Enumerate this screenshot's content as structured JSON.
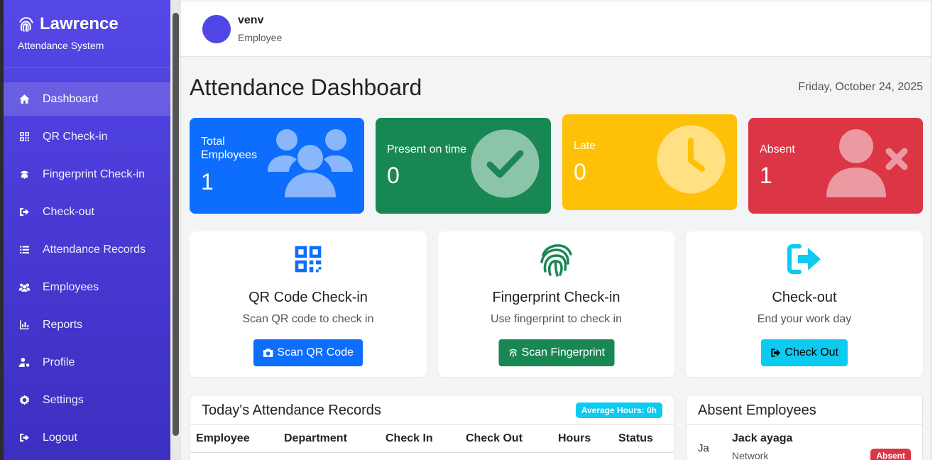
{
  "brand": {
    "title": "Lawrence",
    "subtitle": "Attendance System"
  },
  "sidebar": {
    "items": [
      {
        "label": "Dashboard",
        "icon": "home-icon",
        "active": true
      },
      {
        "label": "QR Check-in",
        "icon": "qrcode-icon"
      },
      {
        "label": "Fingerprint Check-in",
        "icon": "fingerprint-icon"
      },
      {
        "label": "Check-out",
        "icon": "sign-out-icon"
      },
      {
        "label": "Attendance Records",
        "icon": "list-icon"
      },
      {
        "label": "Employees",
        "icon": "users-icon"
      },
      {
        "label": "Reports",
        "icon": "chart-icon"
      },
      {
        "label": "Profile",
        "icon": "user-cog-icon"
      },
      {
        "label": "Settings",
        "icon": "gear-icon"
      },
      {
        "label": "Logout",
        "icon": "logout-icon"
      }
    ]
  },
  "user": {
    "name": "venv",
    "role": "Employee",
    "avatar_color": "#4f46e5"
  },
  "page": {
    "title": "Attendance Dashboard",
    "date": "Friday, October 24, 2025"
  },
  "stats": {
    "total": {
      "label": "Total Employees",
      "value": "1",
      "color": "#0d6efd"
    },
    "present": {
      "label": "Present on time",
      "value": "0",
      "color": "#198754"
    },
    "late": {
      "label": "Late",
      "value": "0",
      "color": "#ffc107"
    },
    "absent": {
      "label": "Absent",
      "value": "1",
      "color": "#dc3545"
    }
  },
  "actions": {
    "qr": {
      "title": "QR Code Check-in",
      "desc": "Scan QR code to check in",
      "button": "Scan QR Code",
      "color": "#0d6efd"
    },
    "fingerprint": {
      "title": "Fingerprint Check-in",
      "desc": "Use fingerprint to check in",
      "button": "Scan Fingerprint",
      "color": "#198754"
    },
    "checkout": {
      "title": "Check-out",
      "desc": "End your work day",
      "button": "Check Out",
      "color": "#0dcaf0"
    }
  },
  "records": {
    "title": "Today's Attendance Records",
    "avg_badge": "Average Hours: 0h",
    "columns": [
      "Employee",
      "Department",
      "Check In",
      "Check Out",
      "Hours",
      "Status"
    ]
  },
  "absent_panel": {
    "title": "Absent Employees",
    "items": [
      {
        "img_alt": "Ja",
        "name": "Jack ayaga",
        "dept": "Network",
        "status": "Absent"
      }
    ]
  }
}
